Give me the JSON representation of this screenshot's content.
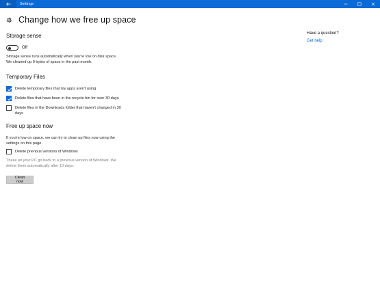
{
  "window": {
    "title": "Settings",
    "back_icon": "arrow-left-icon",
    "controls": [
      "minimize-icon",
      "maximize-icon",
      "close-icon"
    ],
    "titlebar_color": "#0a6ad6"
  },
  "header": {
    "icon": "gear-icon",
    "title": "Change how we free up space"
  },
  "storage_sense": {
    "heading": "Storage sense",
    "toggle_state": "Off",
    "toggle_on": false,
    "description_lines": [
      "Storage sense runs automatically when you're low on disk space.",
      "We cleaned up 0 bytes of space in the past month."
    ]
  },
  "temporary_files": {
    "heading": "Temporary Files",
    "options": [
      {
        "label_lines": [
          "Delete temporary files that my apps aren't using"
        ],
        "checked": true
      },
      {
        "label_lines": [
          "Delete files that have been in the recycle bin for over 30 days"
        ],
        "checked": true
      },
      {
        "label_lines": [
          "Delete files in the Downloads folder that haven't changed in 30",
          "days"
        ],
        "checked": false
      }
    ]
  },
  "free_up_space": {
    "heading": "Free up space now",
    "description_lines": [
      "If you're low on space, we can try to clean up files now using the",
      "settings on this page."
    ],
    "previous_versions": {
      "label": "Delete previous versions of Windows",
      "checked": false
    },
    "note_lines": [
      "These let your PC go back to a previous version of Windows. We",
      "delete them automatically after 10 days."
    ],
    "button_label": "Clean now"
  },
  "help": {
    "title": "Have a question?",
    "link": "Get help"
  },
  "colors": {
    "accent": "#0a6ad6"
  }
}
